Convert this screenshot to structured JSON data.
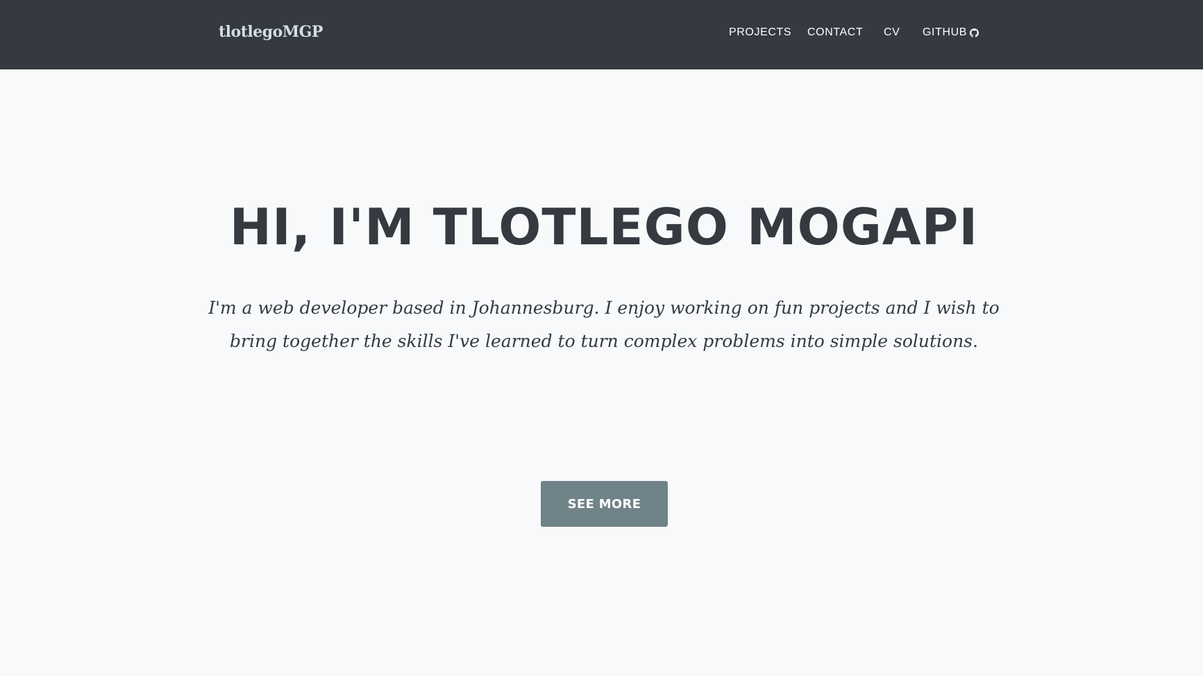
{
  "navbar": {
    "brand": "tlotlegoMGP",
    "links": [
      {
        "label": "PROJECTS"
      },
      {
        "label": "CONTACT"
      },
      {
        "label": "CV"
      },
      {
        "label": "GITHUB",
        "icon": "github-icon"
      }
    ]
  },
  "hero": {
    "title": "HI, I'M TLOTLEGO MOGAPI",
    "text": "I'm a web developer based in Johannesburg. I enjoy working on fun projects and I wish to bring together the skills I've learned to turn complex problems into simple solutions.",
    "button_label": "SEE MORE"
  },
  "colors": {
    "navbar_bg": "#343a40",
    "page_bg": "#f8f9fa",
    "text": "#343a40",
    "button_bg": "#708389",
    "brand": "#d5dde1"
  }
}
